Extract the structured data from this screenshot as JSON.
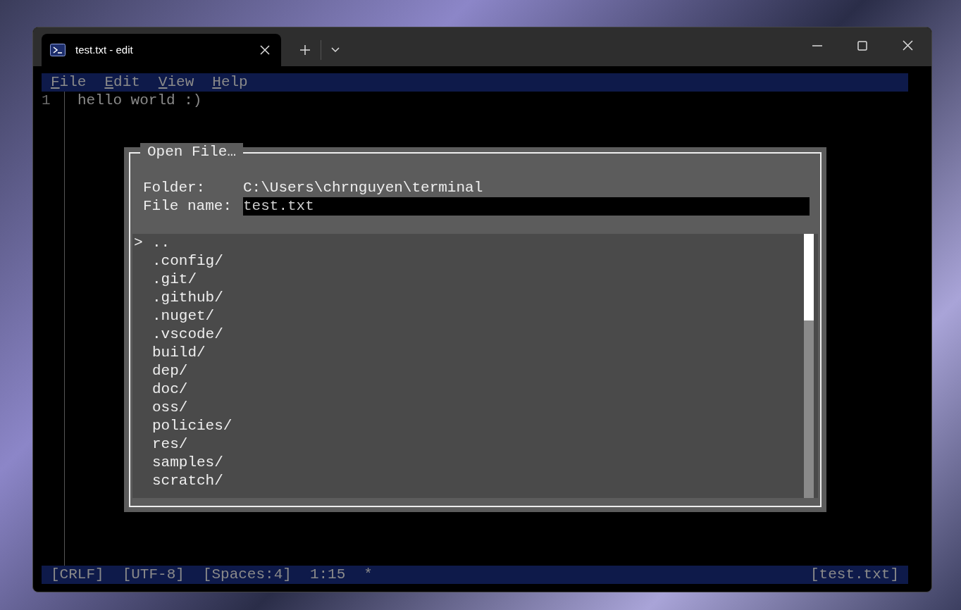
{
  "tab": {
    "title": "test.txt - edit",
    "selected": true
  },
  "menu": [
    {
      "label": "File"
    },
    {
      "label": "Edit"
    },
    {
      "label": "View"
    },
    {
      "label": "Help"
    }
  ],
  "editor": {
    "lines": [
      {
        "number": "1",
        "text": "hello world :)"
      }
    ]
  },
  "dialog": {
    "title": "Open File…",
    "folder_label": "Folder:",
    "folder": "C:\\Users\\chrnguyen\\terminal",
    "file_name_label": "File name:",
    "file_name": "test.txt",
    "cursor": ">",
    "entries": [
      {
        "name": "..",
        "selected": true
      },
      {
        "name": ".config/",
        "selected": false
      },
      {
        "name": ".git/",
        "selected": false
      },
      {
        "name": ".github/",
        "selected": false
      },
      {
        "name": ".nuget/",
        "selected": false
      },
      {
        "name": ".vscode/",
        "selected": false
      },
      {
        "name": "build/",
        "selected": false
      },
      {
        "name": "dep/",
        "selected": false
      },
      {
        "name": "doc/",
        "selected": false
      },
      {
        "name": "oss/",
        "selected": false
      },
      {
        "name": "policies/",
        "selected": false
      },
      {
        "name": "res/",
        "selected": false
      },
      {
        "name": "samples/",
        "selected": false
      },
      {
        "name": "scratch/",
        "selected": false
      }
    ]
  },
  "status_bar": {
    "items": [
      "[CRLF]",
      "[UTF-8]",
      "[Spaces:4]",
      "1:15",
      "*"
    ],
    "file": "[test.txt]"
  }
}
